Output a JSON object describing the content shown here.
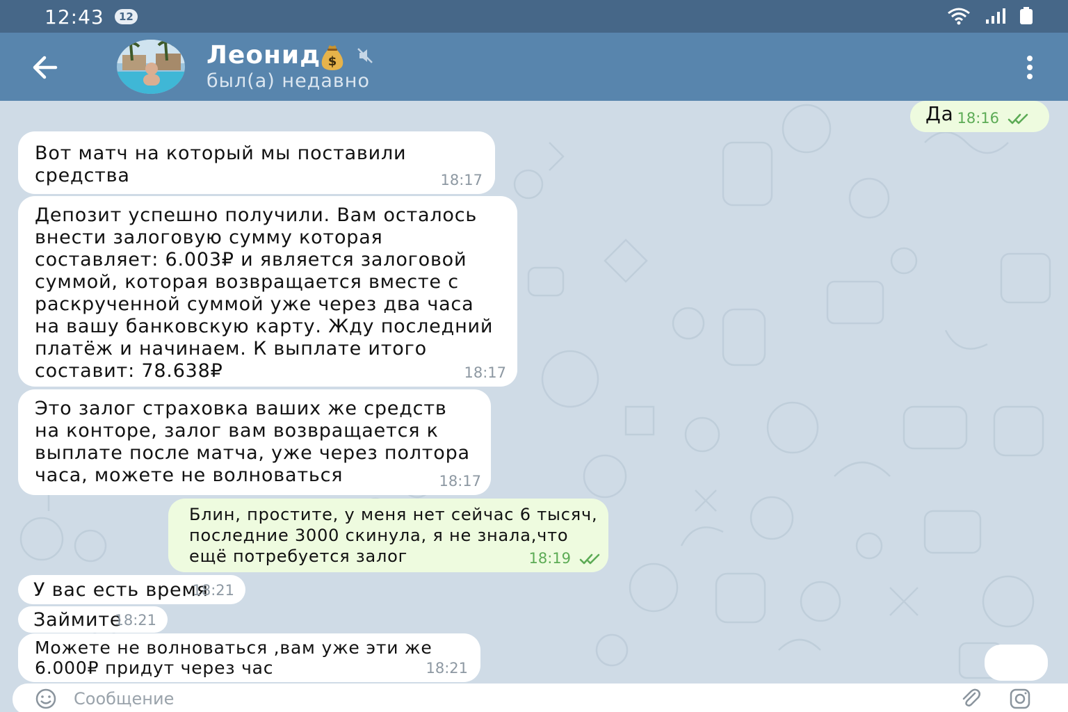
{
  "status_bar": {
    "time": "12:43",
    "notification_count": "12",
    "icons": [
      "wifi-icon",
      "signal-icon",
      "battery-icon"
    ]
  },
  "header": {
    "contact_name": "Леонид",
    "name_emoji": "money-bag-icon",
    "muted": true,
    "status": "был(а) недавно",
    "back_icon": "arrow-left-icon",
    "menu_icon": "more-vertical-icon"
  },
  "messages": [
    {
      "direction": "out",
      "text": "Да",
      "time": "18:16",
      "read": true
    },
    {
      "direction": "in",
      "text": "Вот матч на который мы поставили\nсредства",
      "time": "18:17"
    },
    {
      "direction": "in",
      "text": "Депозит успешно получили. Вам осталось\nвнести залоговую сумму которая\nсоставляет: 6.003₽ и является залоговой\nсуммой, которая возвращается вместе с\nраскрученной суммой уже через два часа\nна вашу банковскую карту. Жду последний\nплатёж и начинаем. К выплате итого\nсоставит: 78.638₽",
      "time": "18:17"
    },
    {
      "direction": "in",
      "text": "Это залог страховка ваших же средств\nна конторе, залог вам возвращается к\nвыплате после матча, уже через полтора\nчаса, можете не волноваться",
      "time": "18:17"
    },
    {
      "direction": "out",
      "text": "Блин, простите, у меня нет сейчас 6 тысяч,\nпоследние 3000 скинула, я не знала,что\nещё потребуется залог",
      "time": "18:19",
      "read": true
    },
    {
      "direction": "in",
      "text": "У вас есть время",
      "time": "18:21"
    },
    {
      "direction": "in",
      "text": "Займите",
      "time": "18:21"
    },
    {
      "direction": "in",
      "text": "Можете не волноваться ,вам уже эти же\n6.000₽ придут через час",
      "time": "18:21"
    }
  ],
  "input": {
    "placeholder": "Сообщение",
    "value": "",
    "icons": [
      "emoji-icon",
      "paperclip-icon",
      "camera-icon"
    ]
  },
  "colors": {
    "status_bar": "#466788",
    "header": "#5885ad",
    "chat_background": "#cfdbe6",
    "incoming_bubble": "#ffffff",
    "outgoing_bubble": "#eefbdf",
    "outgoing_time": "#5cab55"
  }
}
